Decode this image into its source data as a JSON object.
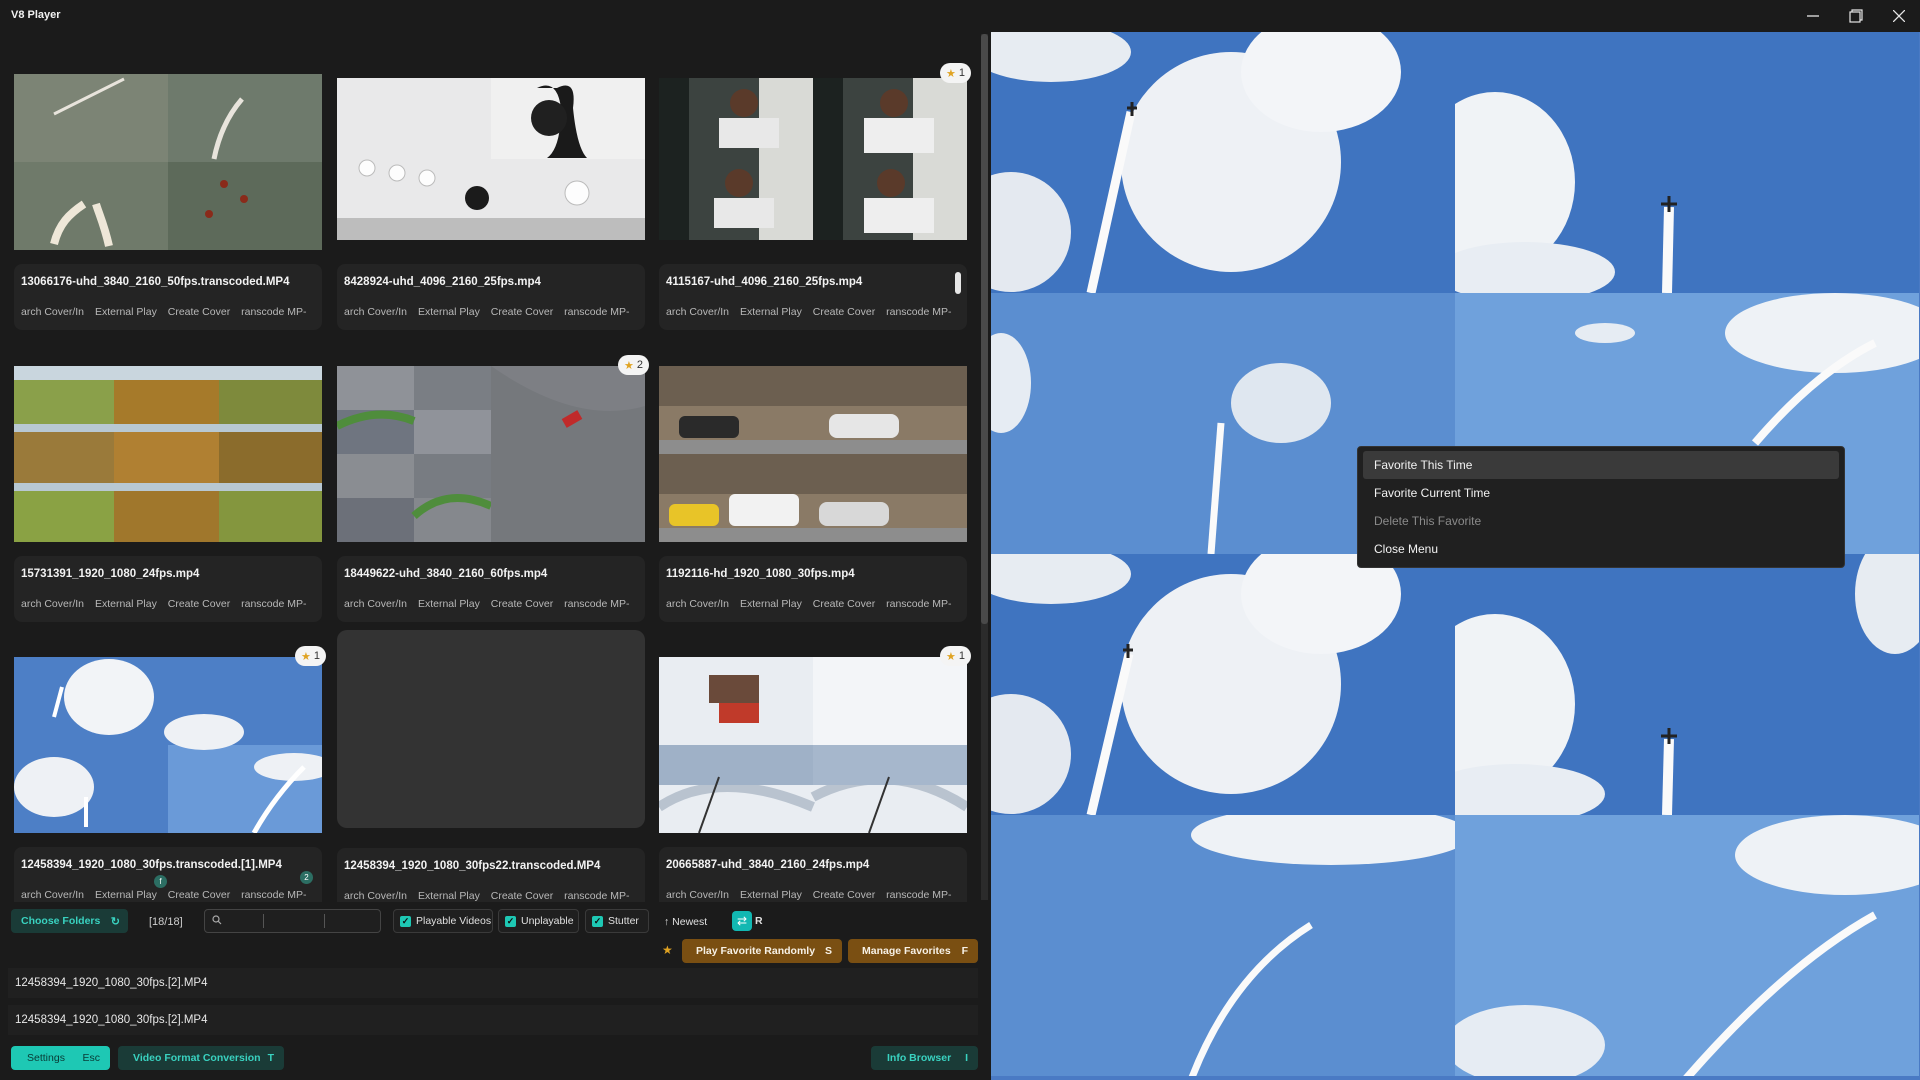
{
  "app": {
    "title": "V8 Player"
  },
  "window": {
    "minimize_icon": "minimize-icon",
    "maximize_icon": "maximize-icon",
    "close_icon": "close-icon"
  },
  "videos": [
    {
      "filename": "13066176-uhd_3840_2160_50fps.transcoded.MP4",
      "favorites": null,
      "thumb": "jets-smoke"
    },
    {
      "filename": "8428924-uhd_4096_2160_25fps.mp4",
      "favorites": null,
      "thumb": "chess-pieces"
    },
    {
      "filename": "4115167-uhd_4096_2160_25fps.mp4",
      "favorites": "1",
      "thumb": "chess-player"
    },
    {
      "filename": "15731391_1920_1080_24fps.mp4",
      "favorites": null,
      "thumb": "autumn-aerial"
    },
    {
      "filename": "18449622-uhd_3840_2160_60fps.mp4",
      "favorites": "2",
      "thumb": "race-track"
    },
    {
      "filename": "1192116-hd_1920_1080_30fps.mp4",
      "favorites": null,
      "thumb": "street-cars"
    },
    {
      "filename": "12458394_1920_1080_30fps.transcoded.[1].MP4",
      "favorites": "1",
      "thumb": "sky-jets",
      "badge": "2"
    },
    {
      "filename": "12458394_1920_1080_30fps22.transcoded.MP4",
      "favorites": null,
      "thumb": "empty"
    },
    {
      "filename": "20665887-uhd_3840_2160_24fps.mp4",
      "favorites": "1",
      "thumb": "snow-resort"
    }
  ],
  "card_actions": [
    "arch Cover/In",
    "External Play",
    "Create Cover",
    "ranscode MP-"
  ],
  "toolbar": {
    "choose_folders": "Choose Folders",
    "refresh_icon": "refresh-icon",
    "count": "[18/18]",
    "search_placeholder": "",
    "playable_videos": "Playable Videos",
    "unplayable": "Unplayable",
    "stutter": "Stutter",
    "sort_label": "Newest",
    "random_label": "R"
  },
  "favorites_bar": {
    "play_random": "Play Favorite Randomly",
    "play_random_key": "S",
    "manage": "Manage Favorites",
    "manage_key": "F"
  },
  "recent": [
    "12458394_1920_1080_30fps.[2].MP4",
    "12458394_1920_1080_30fps.[2].MP4"
  ],
  "bottom": {
    "settings": "Settings",
    "settings_key": "Esc",
    "video_format": "Video Format Conversion",
    "video_format_key": "T",
    "info_browser": "Info Browser",
    "info_browser_key": "I"
  },
  "context_menu": {
    "items": [
      "Favorite This Time",
      "Favorite Current Time",
      "Delete This Favorite",
      "Close Menu"
    ],
    "disabled_index": 2,
    "hover_index": 0
  },
  "colors": {
    "accent_teal": "#1ec8b4",
    "favorite_gold": "#7a4f12",
    "star": "#e0a322"
  }
}
